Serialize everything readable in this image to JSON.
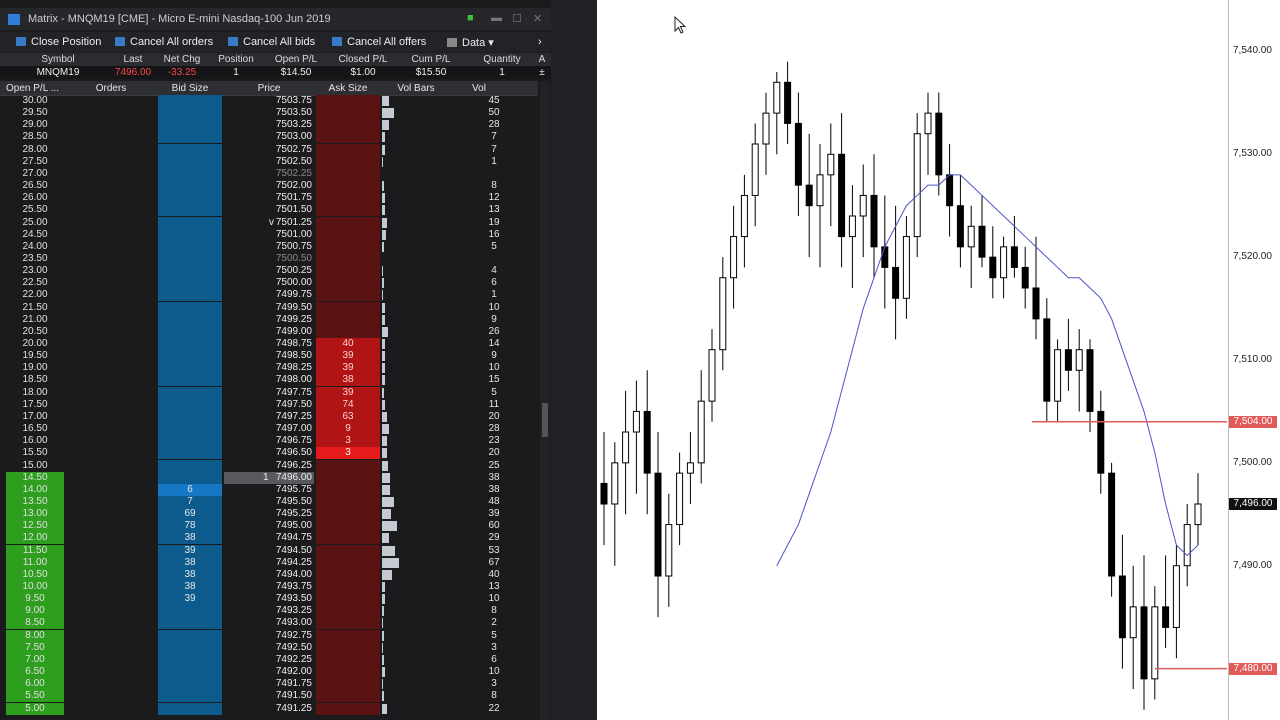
{
  "window": {
    "title": "Matrix - MNQM19 [CME] - Micro E-mini Nasdaq-100 Jun 2019"
  },
  "toolbar": {
    "close_position": "Close Position",
    "cancel_all_orders": "Cancel All orders",
    "cancel_all_bids": "Cancel All bids",
    "cancel_all_offers": "Cancel All offers",
    "data": "Data ▾",
    "more": "›"
  },
  "summary": {
    "headers": [
      "Symbol",
      "Last",
      "Net Chg",
      "Position",
      "Open P/L",
      "Closed P/L",
      "Cum P/L",
      "Quantity",
      "A"
    ],
    "values": [
      "MNQM19",
      "7496.00",
      "-33.25",
      "1",
      "$14.50",
      "$1.00",
      "$15.50",
      "1",
      "±"
    ],
    "colors": {
      "last": "#ff4444",
      "net_chg": "#ff4444"
    }
  },
  "ladder": {
    "headers": [
      "Open P/L ...",
      "Orders",
      "Bid Size",
      "Price",
      "Ask Size",
      "Vol Bars",
      "Vol"
    ],
    "rows": [
      {
        "pl": "30.00",
        "price": "7503.75",
        "bid": "",
        "ask": "",
        "vol": "45",
        "vbar": 0.1
      },
      {
        "pl": "29.50",
        "price": "7503.50",
        "bid": "",
        "ask": "",
        "vol": "50",
        "vbar": 0.18
      },
      {
        "pl": "29.00",
        "price": "7503.25",
        "bid": "",
        "ask": "",
        "vol": "28",
        "vbar": 0.1
      },
      {
        "pl": "28.50",
        "price": "7503.00",
        "bid": "",
        "ask": "",
        "vol": "7",
        "vbar": 0.04
      },
      {
        "pl": "28.00",
        "price": "7502.75",
        "bid": "",
        "ask": "",
        "vol": "7",
        "vbar": 0.04
      },
      {
        "pl": "27.50",
        "price": "7502.50",
        "bid": "",
        "ask": "",
        "vol": "1",
        "vbar": 0.02
      },
      {
        "pl": "27.00",
        "price": "7502.25",
        "bid": "",
        "ask": "",
        "vol": "",
        "vbar": 0,
        "dim": true
      },
      {
        "pl": "26.50",
        "price": "7502.00",
        "bid": "",
        "ask": "",
        "vol": "8",
        "vbar": 0.03
      },
      {
        "pl": "26.00",
        "price": "7501.75",
        "bid": "",
        "ask": "",
        "vol": "12",
        "vbar": 0.05
      },
      {
        "pl": "25.50",
        "price": "7501.50",
        "bid": "",
        "ask": "",
        "vol": "13",
        "vbar": 0.05
      },
      {
        "pl": "25.00",
        "price": "7501.25",
        "bid": "",
        "ask": "",
        "vol": "19",
        "vbar": 0.07,
        "mark": "v"
      },
      {
        "pl": "24.50",
        "price": "7501.00",
        "bid": "",
        "ask": "",
        "vol": "16",
        "vbar": 0.06
      },
      {
        "pl": "24.00",
        "price": "7500.75",
        "bid": "",
        "ask": "",
        "vol": "5",
        "vbar": 0.03
      },
      {
        "pl": "23.50",
        "price": "7500.50",
        "bid": "",
        "ask": "",
        "vol": "",
        "vbar": 0,
        "dim": true
      },
      {
        "pl": "23.00",
        "price": "7500.25",
        "bid": "",
        "ask": "",
        "vol": "4",
        "vbar": 0.02
      },
      {
        "pl": "22.50",
        "price": "7500.00",
        "bid": "",
        "ask": "",
        "vol": "6",
        "vbar": 0.03
      },
      {
        "pl": "22.00",
        "price": "7499.75",
        "bid": "",
        "ask": "",
        "vol": "1",
        "vbar": 0.02
      },
      {
        "pl": "21.50",
        "price": "7499.50",
        "bid": "",
        "ask": "",
        "vol": "10",
        "vbar": 0.04
      },
      {
        "pl": "21.00",
        "price": "7499.25",
        "bid": "",
        "ask": "",
        "vol": "9",
        "vbar": 0.04
      },
      {
        "pl": "20.50",
        "price": "7499.00",
        "bid": "",
        "ask": "",
        "vol": "26",
        "vbar": 0.09
      },
      {
        "pl": "20.00",
        "price": "7498.75",
        "bid": "",
        "ask": "40",
        "vol": "14",
        "vbar": 0.05
      },
      {
        "pl": "19.50",
        "price": "7498.50",
        "bid": "",
        "ask": "39",
        "vol": "9",
        "vbar": 0.04
      },
      {
        "pl": "19.00",
        "price": "7498.25",
        "bid": "",
        "ask": "39",
        "vol": "10",
        "vbar": 0.04
      },
      {
        "pl": "18.50",
        "price": "7498.00",
        "bid": "",
        "ask": "38",
        "vol": "15",
        "vbar": 0.05
      },
      {
        "pl": "18.00",
        "price": "7497.75",
        "bid": "",
        "ask": "39",
        "vol": "5",
        "vbar": 0.03
      },
      {
        "pl": "17.50",
        "price": "7497.50",
        "bid": "",
        "ask": "74",
        "vol": "11",
        "vbar": 0.05
      },
      {
        "pl": "17.00",
        "price": "7497.25",
        "bid": "",
        "ask": "63",
        "vol": "20",
        "vbar": 0.07
      },
      {
        "pl": "16.50",
        "price": "7497.00",
        "bid": "",
        "ask": "9",
        "vol": "28",
        "vbar": 0.1
      },
      {
        "pl": "16.00",
        "price": "7496.75",
        "bid": "",
        "ask": "3",
        "vol": "23",
        "vbar": 0.08
      },
      {
        "pl": "15.50",
        "price": "7496.50",
        "bid": "",
        "ask": "3",
        "vol": "20",
        "vbar": 0.07,
        "best_ask": true
      },
      {
        "pl": "15.00",
        "price": "7496.25",
        "bid": "",
        "ask": "",
        "vol": "25",
        "vbar": 0.09
      },
      {
        "pl": "14.50",
        "price": "7496.00",
        "bid": "",
        "ask": "",
        "vol": "38",
        "vbar": 0.12,
        "last": true,
        "pos": "1",
        "green": true
      },
      {
        "pl": "14.00",
        "price": "7495.75",
        "bid": "6",
        "ask": "",
        "vol": "38",
        "vbar": 0.12,
        "green": true,
        "best_bid": true
      },
      {
        "pl": "13.50",
        "price": "7495.50",
        "bid": "7",
        "ask": "",
        "vol": "48",
        "vbar": 0.17,
        "green": true
      },
      {
        "pl": "13.00",
        "price": "7495.25",
        "bid": "69",
        "ask": "",
        "vol": "39",
        "vbar": 0.13,
        "green": true
      },
      {
        "pl": "12.50",
        "price": "7495.00",
        "bid": "78",
        "ask": "",
        "vol": "60",
        "vbar": 0.22,
        "green": true
      },
      {
        "pl": "12.00",
        "price": "7494.75",
        "bid": "38",
        "ask": "",
        "vol": "29",
        "vbar": 0.1,
        "green": true
      },
      {
        "pl": "11.50",
        "price": "7494.50",
        "bid": "39",
        "ask": "",
        "vol": "53",
        "vbar": 0.19,
        "green": true
      },
      {
        "pl": "11.00",
        "price": "7494.25",
        "bid": "38",
        "ask": "",
        "vol": "67",
        "vbar": 0.25,
        "green": true
      },
      {
        "pl": "10.50",
        "price": "7494.00",
        "bid": "38",
        "ask": "",
        "vol": "40",
        "vbar": 0.14,
        "green": true
      },
      {
        "pl": "10.00",
        "price": "7493.75",
        "bid": "38",
        "ask": "",
        "vol": "13",
        "vbar": 0.05,
        "green": true
      },
      {
        "pl": "9.50",
        "price": "7493.50",
        "bid": "39",
        "ask": "",
        "vol": "10",
        "vbar": 0.04,
        "green": true
      },
      {
        "pl": "9.00",
        "price": "7493.25",
        "bid": "",
        "ask": "",
        "vol": "8",
        "vbar": 0.03,
        "green": true
      },
      {
        "pl": "8.50",
        "price": "7493.00",
        "bid": "",
        "ask": "",
        "vol": "2",
        "vbar": 0.02,
        "green": true
      },
      {
        "pl": "8.00",
        "price": "7492.75",
        "bid": "",
        "ask": "",
        "vol": "5",
        "vbar": 0.03,
        "green": true
      },
      {
        "pl": "7.50",
        "price": "7492.50",
        "bid": "",
        "ask": "",
        "vol": "3",
        "vbar": 0.02,
        "green": true
      },
      {
        "pl": "7.00",
        "price": "7492.25",
        "bid": "",
        "ask": "",
        "vol": "6",
        "vbar": 0.03,
        "green": true
      },
      {
        "pl": "6.50",
        "price": "7492.00",
        "bid": "",
        "ask": "",
        "vol": "10",
        "vbar": 0.04,
        "green": true
      },
      {
        "pl": "6.00",
        "price": "7491.75",
        "bid": "",
        "ask": "",
        "vol": "3",
        "vbar": 0.02,
        "green": true
      },
      {
        "pl": "5.50",
        "price": "7491.50",
        "bid": "",
        "ask": "",
        "vol": "8",
        "vbar": 0.03,
        "green": true
      },
      {
        "pl": "5.00",
        "price": "7491.25",
        "bid": "",
        "ask": "",
        "vol": "22",
        "vbar": 0.08,
        "green": true
      }
    ]
  },
  "chart_data": {
    "type": "candlestick",
    "y_labels": [
      "7,540.00",
      "7,530.00",
      "7,520.00",
      "7,510.00",
      "7,500.00",
      "7,490.00",
      "7,480.00"
    ],
    "ylim": [
      7475,
      7545
    ],
    "price_tags": [
      {
        "label": "7,504.00",
        "value": 7504,
        "color": "#e05a5a"
      },
      {
        "label": "7,496.00",
        "value": 7496,
        "color": "#111111"
      },
      {
        "label": "7,480.00",
        "value": 7480,
        "color": "#e05a5a"
      }
    ],
    "candles": [
      [
        7498,
        7503,
        7492,
        7496
      ],
      [
        7496,
        7502,
        7490,
        7500
      ],
      [
        7500,
        7507,
        7495,
        7503
      ],
      [
        7503,
        7508,
        7497,
        7505
      ],
      [
        7505,
        7509,
        7495,
        7499
      ],
      [
        7499,
        7503,
        7485,
        7489
      ],
      [
        7489,
        7497,
        7486,
        7494
      ],
      [
        7494,
        7501,
        7492,
        7499
      ],
      [
        7499,
        7503,
        7496,
        7500
      ],
      [
        7500,
        7509,
        7498,
        7506
      ],
      [
        7506,
        7513,
        7504,
        7511
      ],
      [
        7511,
        7520,
        7509,
        7518
      ],
      [
        7518,
        7525,
        7515,
        7522
      ],
      [
        7522,
        7528,
        7519,
        7526
      ],
      [
        7526,
        7533,
        7523,
        7531
      ],
      [
        7531,
        7536,
        7528,
        7534
      ],
      [
        7534,
        7538,
        7530,
        7537
      ],
      [
        7537,
        7539,
        7531,
        7533
      ],
      [
        7533,
        7536,
        7524,
        7527
      ],
      [
        7527,
        7532,
        7520,
        7525
      ],
      [
        7525,
        7531,
        7519,
        7528
      ],
      [
        7528,
        7533,
        7523,
        7530
      ],
      [
        7530,
        7534,
        7519,
        7522
      ],
      [
        7522,
        7527,
        7517,
        7524
      ],
      [
        7524,
        7529,
        7520,
        7526
      ],
      [
        7526,
        7530,
        7518,
        7521
      ],
      [
        7521,
        7526,
        7515,
        7519
      ],
      [
        7519,
        7525,
        7512,
        7516
      ],
      [
        7516,
        7524,
        7514,
        7522
      ],
      [
        7522,
        7534,
        7520,
        7532
      ],
      [
        7532,
        7536,
        7528,
        7534
      ],
      [
        7534,
        7536,
        7526,
        7528
      ],
      [
        7528,
        7531,
        7522,
        7525
      ],
      [
        7525,
        7528,
        7519,
        7521
      ],
      [
        7521,
        7525,
        7517,
        7523
      ],
      [
        7523,
        7526,
        7519,
        7520
      ],
      [
        7520,
        7523,
        7516,
        7518
      ],
      [
        7518,
        7522,
        7516,
        7521
      ],
      [
        7521,
        7524,
        7518,
        7519
      ],
      [
        7519,
        7521,
        7515,
        7517
      ],
      [
        7517,
        7522,
        7512,
        7514
      ],
      [
        7514,
        7516,
        7504,
        7506
      ],
      [
        7506,
        7512,
        7504,
        7511
      ],
      [
        7511,
        7514,
        7507,
        7509
      ],
      [
        7509,
        7513,
        7505,
        7511
      ],
      [
        7511,
        7512,
        7503,
        7505
      ],
      [
        7505,
        7507,
        7497,
        7499
      ],
      [
        7499,
        7500,
        7487,
        7489
      ],
      [
        7489,
        7493,
        7480,
        7483
      ],
      [
        7483,
        7490,
        7478,
        7486
      ],
      [
        7486,
        7491,
        7476,
        7479
      ],
      [
        7479,
        7488,
        7477,
        7486
      ],
      [
        7486,
        7491,
        7482,
        7484
      ],
      [
        7484,
        7492,
        7481,
        7490
      ],
      [
        7490,
        7496,
        7488,
        7494
      ],
      [
        7494,
        7499,
        7492,
        7496
      ]
    ],
    "sma": [
      7490,
      7492,
      7494,
      7497,
      7500,
      7503,
      7507,
      7511,
      7515,
      7518,
      7521,
      7523,
      7525,
      7526,
      7527,
      7527,
      7528,
      7528,
      7527,
      7526,
      7525,
      7524,
      7523,
      7522,
      7521,
      7520,
      7519,
      7518,
      7518,
      7517,
      7516,
      7514,
      7511,
      7508,
      7505,
      7501,
      7496,
      7492,
      7491,
      7492
    ]
  }
}
